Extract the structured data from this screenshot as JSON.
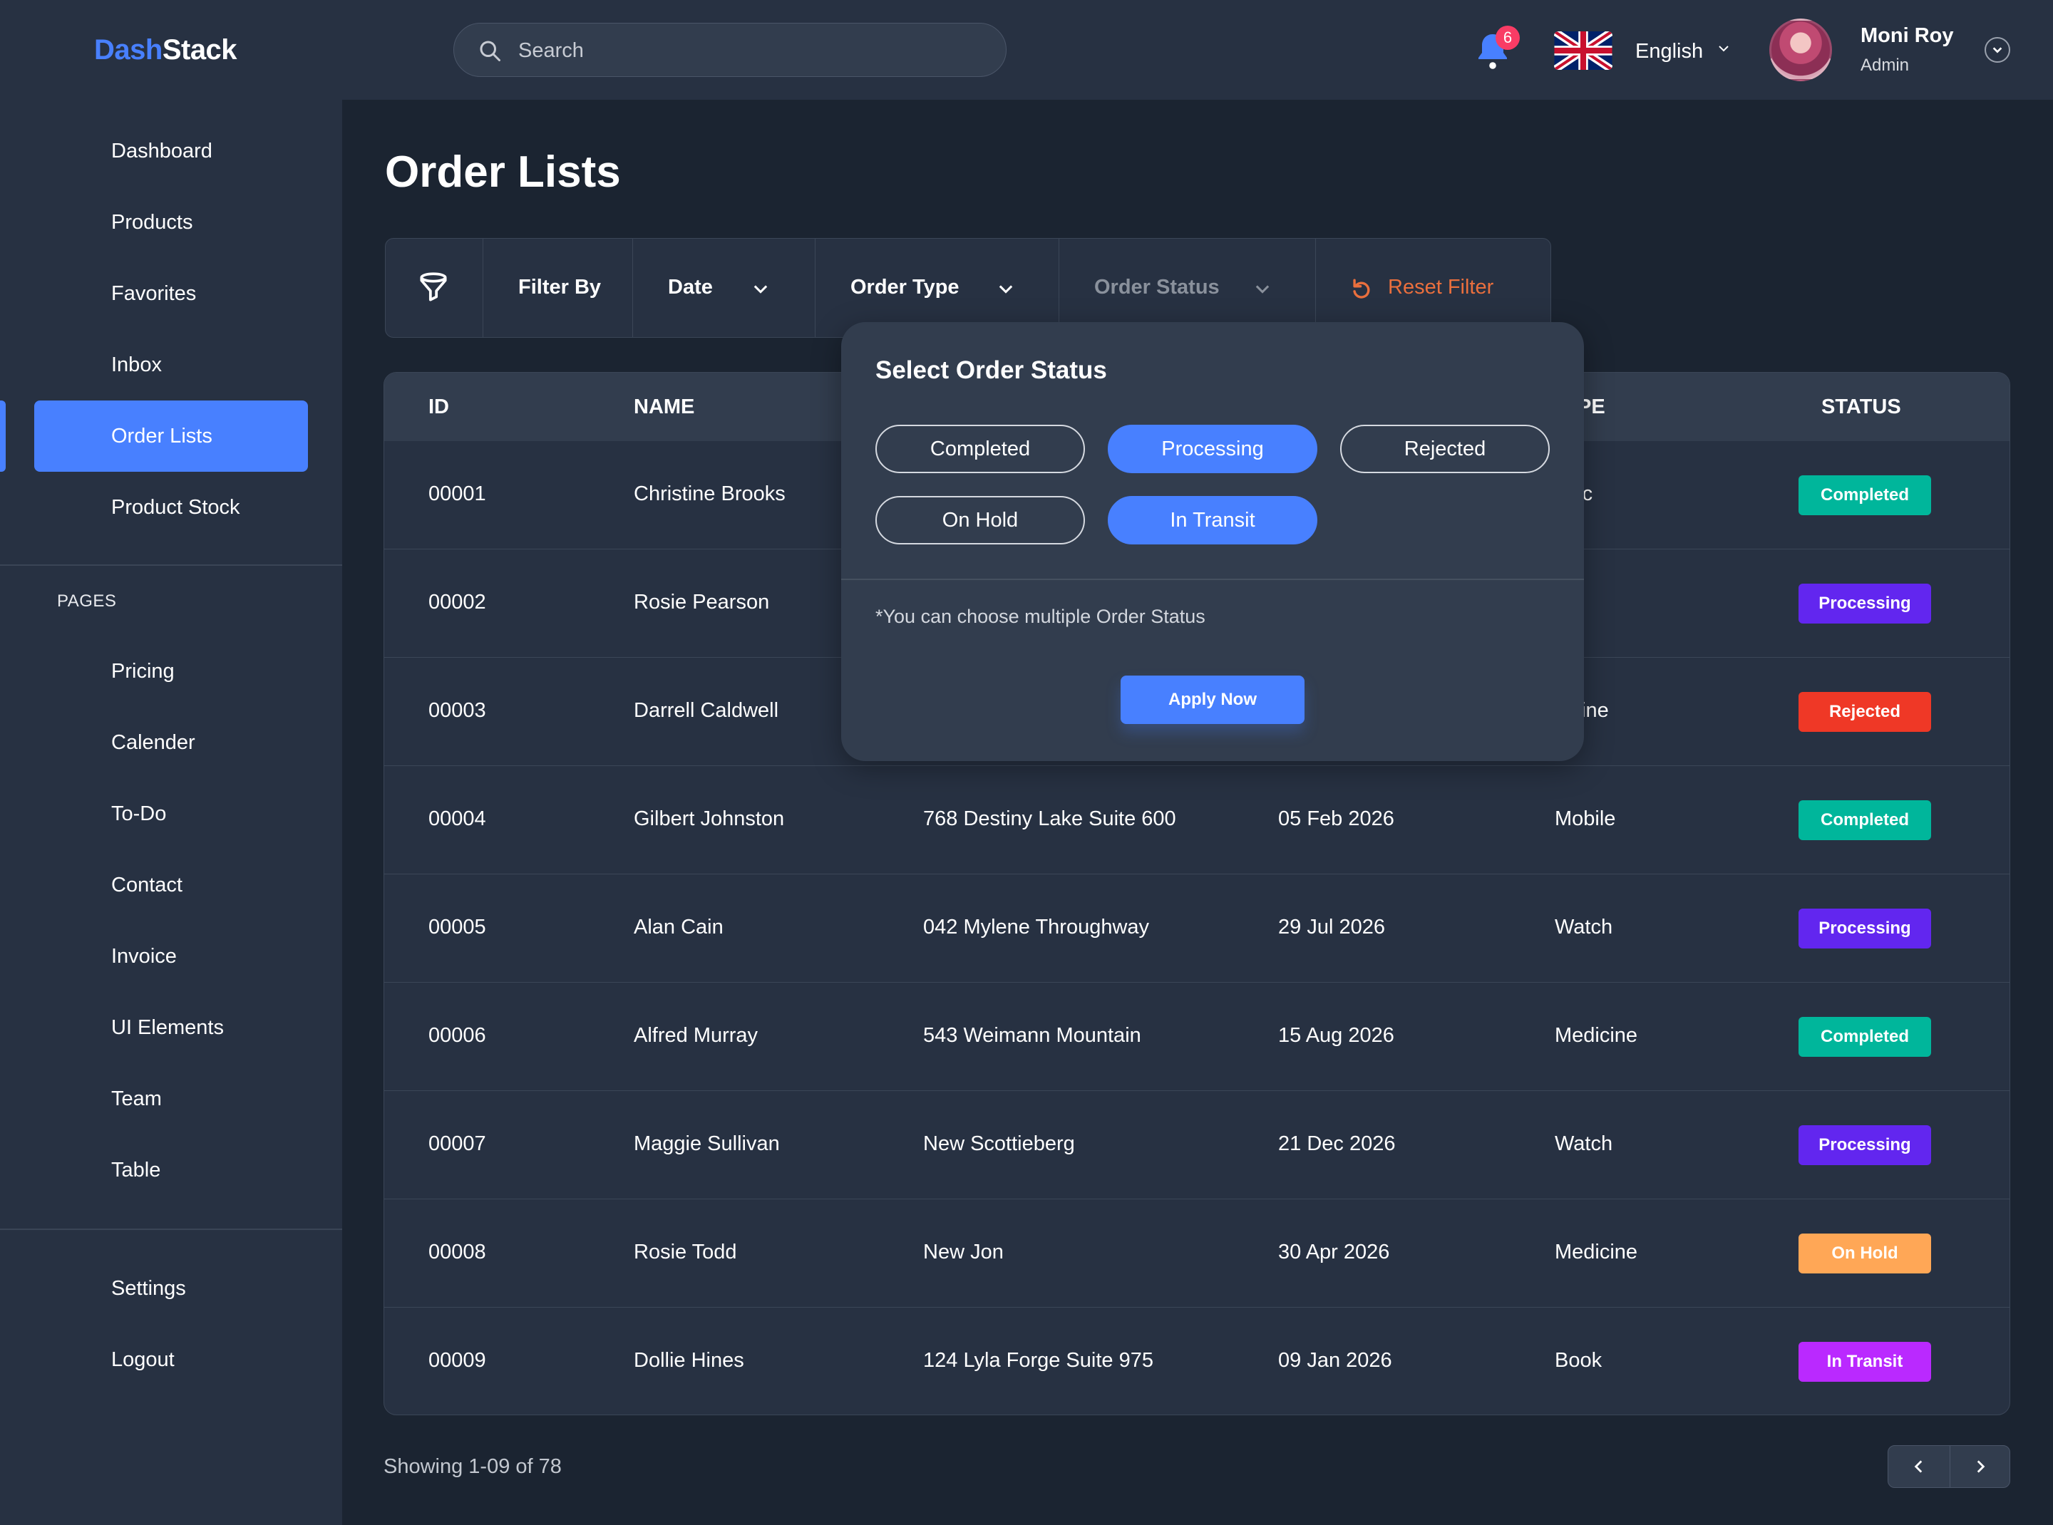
{
  "app": {
    "logo_part1": "Dash",
    "logo_part2": "Stack"
  },
  "header": {
    "search_placeholder": "Search",
    "notification_count": "6",
    "language": "English",
    "user_name": "Moni Roy",
    "user_role": "Admin"
  },
  "sidebar": {
    "main_items": [
      "Dashboard",
      "Products",
      "Favorites",
      "Inbox",
      "Order Lists",
      "Product Stock"
    ],
    "active_item": "Order Lists",
    "section_label": "PAGES",
    "page_items": [
      "Pricing",
      "Calender",
      "To-Do",
      "Contact",
      "Invoice",
      "UI Elements",
      "Team",
      "Table"
    ],
    "bottom_items": [
      "Settings",
      "Logout"
    ]
  },
  "page": {
    "title": "Order Lists"
  },
  "filter": {
    "filter_by": "Filter By",
    "date": "Date",
    "order_type": "Order Type",
    "order_status": "Order Status",
    "reset": "Reset Filter"
  },
  "table": {
    "headers": [
      "ID",
      "NAME",
      "PE",
      "STATUS"
    ],
    "rows": [
      {
        "id": "00001",
        "name": "Christine Brooks",
        "address": "",
        "date": "",
        "type": "ctric",
        "status": "Completed"
      },
      {
        "id": "00002",
        "name": "Rosie Pearson",
        "address": "",
        "date": "",
        "type": "ok",
        "status": "Processing"
      },
      {
        "id": "00003",
        "name": "Darrell Caldwell",
        "address": "",
        "date": "",
        "type": "dicine",
        "status": "Rejected"
      },
      {
        "id": "00004",
        "name": "Gilbert Johnston",
        "address": "768 Destiny Lake Suite 600",
        "date": "05 Feb 2026",
        "type": "Mobile",
        "status": "Completed"
      },
      {
        "id": "00005",
        "name": "Alan Cain",
        "address": "042 Mylene Throughway",
        "date": "29 Jul 2026",
        "type": "Watch",
        "status": "Processing"
      },
      {
        "id": "00006",
        "name": "Alfred Murray",
        "address": "543 Weimann Mountain",
        "date": "15 Aug 2026",
        "type": "Medicine",
        "status": "Completed"
      },
      {
        "id": "00007",
        "name": "Maggie Sullivan",
        "address": "New Scottieberg",
        "date": "21 Dec 2026",
        "type": "Watch",
        "status": "Processing"
      },
      {
        "id": "00008",
        "name": "Rosie Todd",
        "address": "New Jon",
        "date": "30 Apr 2026",
        "type": "Medicine",
        "status": "On Hold"
      },
      {
        "id": "00009",
        "name": "Dollie Hines",
        "address": "124 Lyla Forge Suite 975",
        "date": "09 Jan 2026",
        "type": "Book",
        "status": "In Transit"
      }
    ],
    "status_colors": {
      "Completed": "#00b69b",
      "Processing": "#6226ef",
      "Rejected": "#ef3826",
      "On Hold": "#ffa756",
      "In Transit": "#ba29ff"
    }
  },
  "pagination": {
    "showing": "Showing 1-09 of 78"
  },
  "popup": {
    "title": "Select Order Status",
    "options": [
      {
        "label": "Completed",
        "selected": false
      },
      {
        "label": "Processing",
        "selected": true
      },
      {
        "label": "Rejected",
        "selected": false
      },
      {
        "label": "On Hold",
        "selected": false
      },
      {
        "label": "In Transit",
        "selected": true
      }
    ],
    "note": "*You can choose multiple Order Status",
    "apply": "Apply Now"
  },
  "colors": {
    "accent": "#4880ff",
    "reset": "#ea6f3d",
    "bg": "#1b2431",
    "panel": "#273142"
  }
}
